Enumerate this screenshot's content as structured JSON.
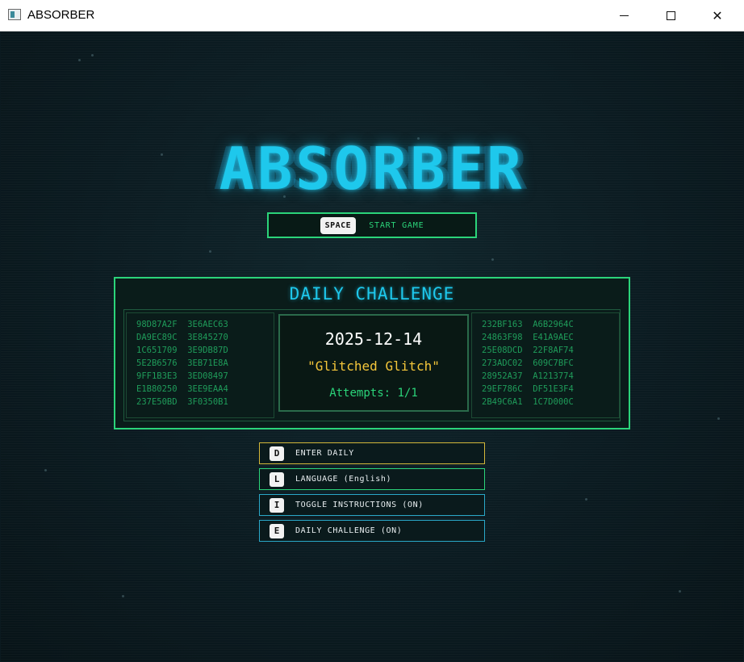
{
  "window": {
    "title": "ABSORBER"
  },
  "game": {
    "logo": "ABSORBER",
    "start": {
      "key": "SPACE",
      "label": "START GAME"
    },
    "daily": {
      "title": "DAILY CHALLENGE",
      "date": "2025-12-14",
      "name": "\"Glitched Glitch\"",
      "attempts": "Attempts: 1/1",
      "hex_left": [
        "98D87A2F  3E6AEC63",
        "DA9EC89C  3E845270",
        "1C651709  3E9DB87D",
        "5E2B6576  3EB71E8A",
        "9FF1B3E3  3ED08497",
        "E1B80250  3EE9EAA4",
        "237E50BD  3F0350B1"
      ],
      "hex_right": [
        "232BF163  A6B2964C",
        "24863F98  E41A9AEC",
        "25E08DCD  22F8AF74",
        "273ADC02  609C7BFC",
        "28952A37  A1213774",
        "29EF786C  DF51E3F4",
        "2B49C6A1  1C7D000C"
      ]
    },
    "menu": [
      {
        "key": "D",
        "label": "ENTER DAILY"
      },
      {
        "key": "L",
        "label": "LANGUAGE (English)"
      },
      {
        "key": "I",
        "label": "TOGGLE INSTRUCTIONS (ON)"
      },
      {
        "key": "E",
        "label": "DAILY CHALLENGE (ON)"
      }
    ]
  }
}
